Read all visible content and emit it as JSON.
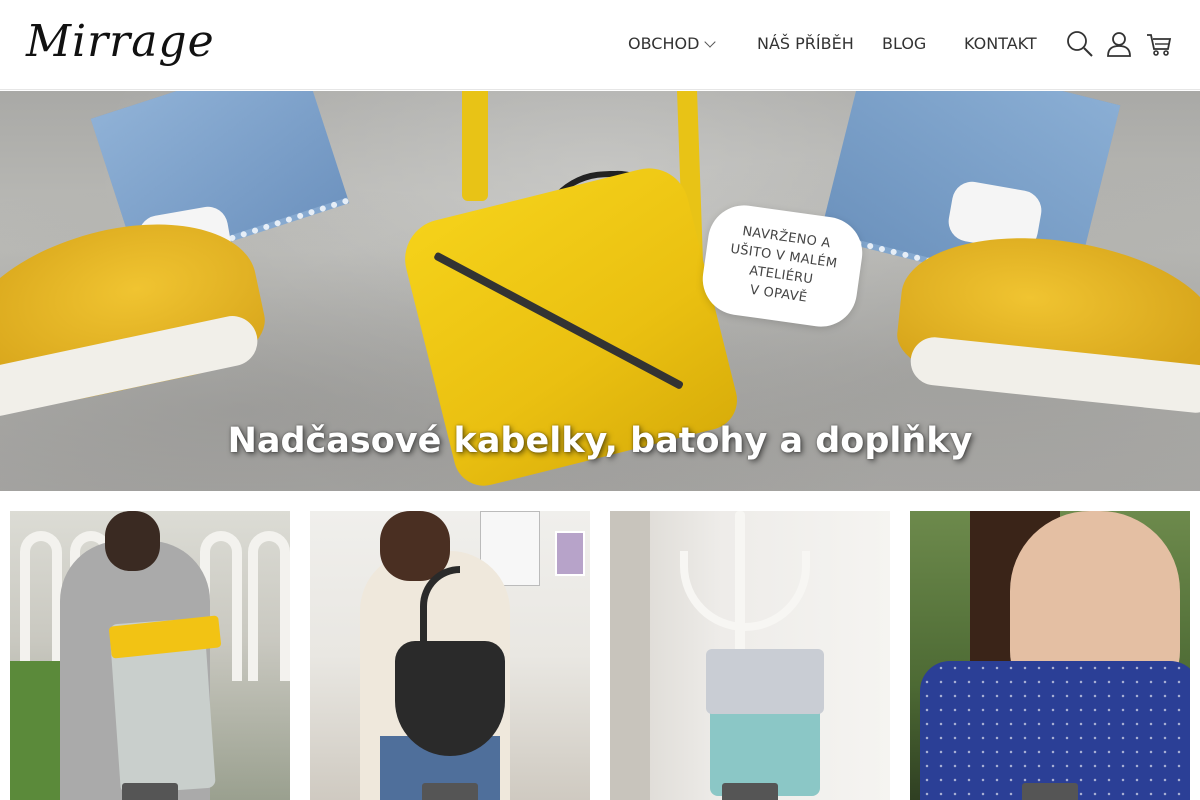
{
  "header": {
    "logo_text": "Mirrage",
    "nav": [
      {
        "label": "OBCHOD"
      },
      {
        "label": "NÁŠ PŘÍBĚH"
      },
      {
        "label": "BLOG"
      },
      {
        "label": "KONTAKT"
      }
    ],
    "icons": {
      "search": "search-icon",
      "user": "user-icon",
      "cart": "cart-icon"
    }
  },
  "hero": {
    "badge": "NAVRŽENO A\nUŠITO V MALÉM\nATELIÉRU\nV OPAVĚ",
    "title": "Nadčasové kabelky, batohy a doplňky"
  },
  "categories": [
    {
      "label": ""
    },
    {
      "label": ""
    },
    {
      "label": ""
    },
    {
      "label": ""
    }
  ],
  "colors": {
    "accent_yellow": "#f2c314",
    "label_bg": "#555555",
    "text": "#333333"
  }
}
